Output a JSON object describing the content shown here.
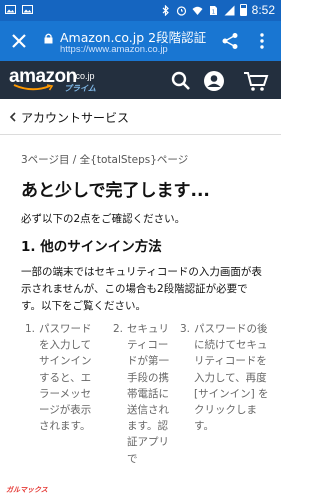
{
  "status_bar": {
    "time": "8:52",
    "icons": [
      "image-icon",
      "image-icon",
      "bluetooth-icon",
      "alarm-icon",
      "wifi-icon",
      "sim-icon",
      "signal-icon",
      "battery-icon"
    ]
  },
  "toolbar": {
    "title": "Amazon.co.jp 2段階認証",
    "url": "https://www.amazon.co.jp",
    "color": "#1976d2"
  },
  "header": {
    "logo_text": "amazon",
    "logo_suffix": ".co.jp",
    "prime_label": "プライム",
    "color": "#232f3e"
  },
  "breadcrumb": {
    "label": "アカウントサービス"
  },
  "main": {
    "step_text": "3ページ目 / 全{totalSteps}ページ",
    "heading": "あと少しで完了します...",
    "confirm_text": "必ず以下の2点をご確認ください。",
    "section_title": "1. 他のサインイン方法",
    "paragraph": "一部の端末ではセキュリティコードの入力画面が表示されませんが、この場合も2段階認証が必要です。以下をご覧ください。",
    "steps": [
      {
        "num": "1.",
        "text": "パスワードを入力してサインインすると、エラーメッセージが表示されます。"
      },
      {
        "num": "2.",
        "text": "セキュリティコードが第一手段の携帯電話に送信されます。認証アプリで"
      },
      {
        "num": "3.",
        "text": "パスワードの後に続けてセキュリティコードを入力して、再度 [サインイン] をクリックします。"
      }
    ]
  },
  "watermark": "ガルマックス"
}
